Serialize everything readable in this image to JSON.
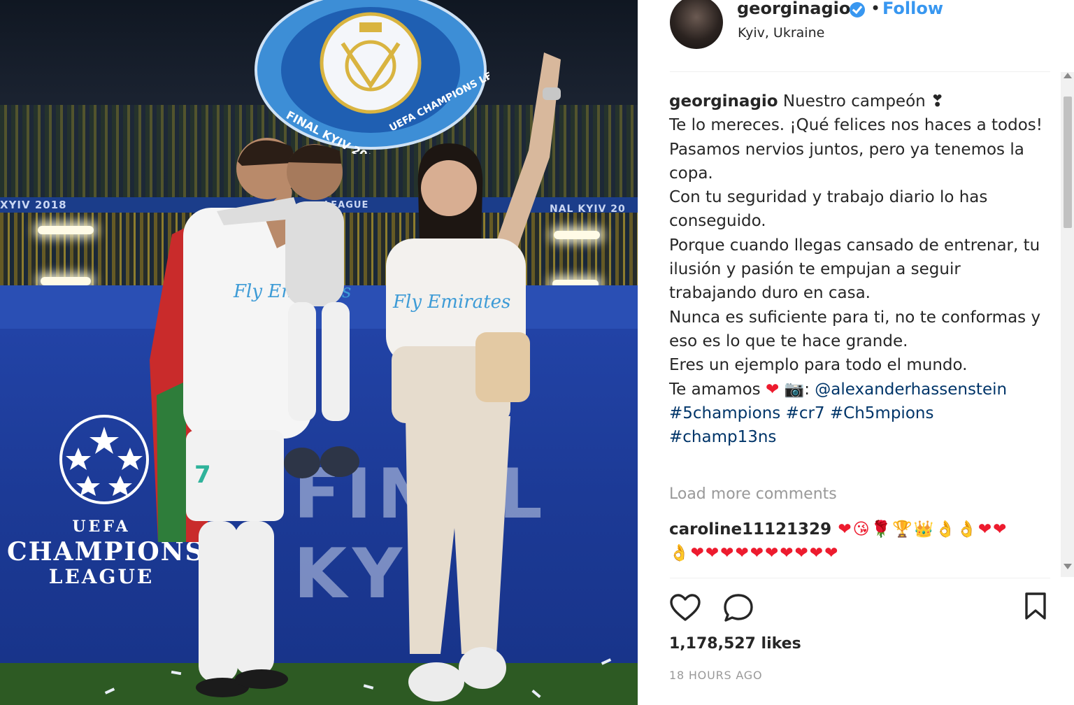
{
  "post": {
    "username": "georginagio",
    "follow_label": "Follow",
    "separator": "•",
    "location": "Kyiv, Ukraine"
  },
  "photo": {
    "band_left": "XYIV 2018",
    "band_mid": "LEAGUE",
    "band_right": "NAL KYIV 20",
    "wall_text": "FINAL KYI",
    "ucl_uefa": "UEFA",
    "ucl_champions": "CHAMPIONS",
    "ucl_league": "LEAGUE",
    "balloon_left": "FINAL KYIV 2018",
    "balloon_right": "UEFA CHAMPIONS LEAGUE",
    "shirt_text_1": "Fly Emirates",
    "shirt_text_2": "Fly Emirates",
    "shirt_number": "7"
  },
  "caption": {
    "username": "georginagio",
    "line_1": " Nuestro campeón ❣\nTe lo mereces. ¡Qué felices nos haces a todos!\nPasamos nervios juntos, pero ya tenemos la copa.\nCon tu seguridad y trabajo diario lo has conseguido.\nPorque cuando llegas cansado de entrenar, tu ilusión y pasión te empujan a seguir trabajando duro en casa.\nNunca es suficiente para ti, no te conformas y eso es lo que te hace grande.\nEres un ejemplo para todo el mundo.\nTe amamos ",
    "heart": "❤",
    "camera": " 📷: ",
    "mention": "@alexanderhassenstein",
    "hashtags": [
      "#5champions",
      "#cr7",
      "#Ch5mpions",
      "#champ13ns"
    ]
  },
  "load_more": "Load more comments",
  "comment": {
    "username": "caroline11121329",
    "text": " ❤😘🌹🏆👑👌👌❤❤\n👌❤❤❤❤❤❤❤❤❤❤"
  },
  "actions": {
    "like_icon": "heart-outline-icon",
    "comment_icon": "speech-bubble-icon",
    "save_icon": "bookmark-icon"
  },
  "likes": "1,178,527 likes",
  "timestamp": "18 HOURS AGO",
  "colors": {
    "link": "#003569",
    "follow": "#3897f0",
    "muted": "#999999",
    "heart": "#ed1b2e"
  }
}
